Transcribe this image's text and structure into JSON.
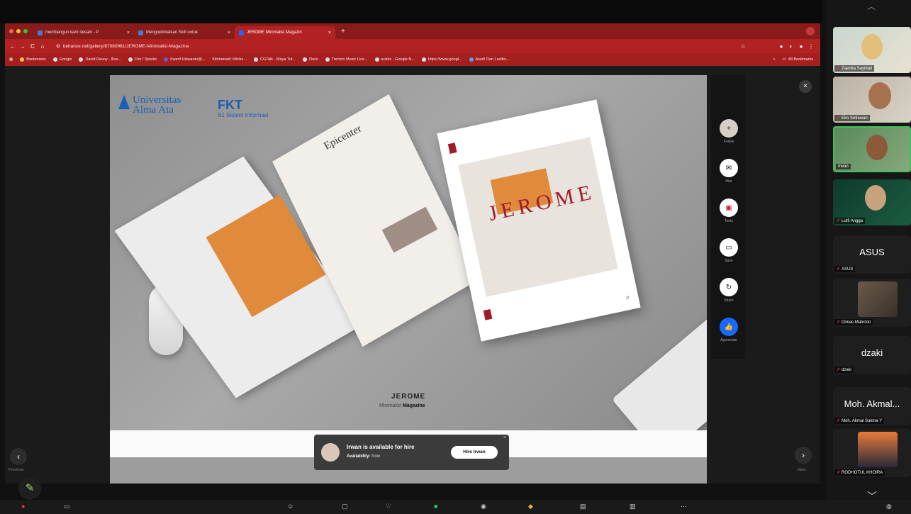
{
  "browser": {
    "tabs": [
      {
        "label": "membangun karir desain - P"
      },
      {
        "label": "Mengoptimalkan Skill untuk"
      },
      {
        "label": "JEROME Minimalist Magazin"
      }
    ],
    "url": "behance.net/gallery/87080981/JEROME-Minimalist-Magazine",
    "bookmarks": [
      "Bookmarks",
      "Google",
      "David Revoy - Illus...",
      "Fire / Sparks",
      "Irwanf Hiswanto@...",
      "Kitchenaid: Kitche...",
      "CGTalk - Maya Tut...",
      "Docs",
      "Trenton Music Lice...",
      "autolx - Google N...",
      "https://www.googl...",
      "Arazil Dan Lucifer..."
    ],
    "all_bookmarks": "All Bookmarks"
  },
  "project": {
    "uni_line1": "Universitas",
    "uni_line2": "Alma Ata",
    "fkt": "FKT",
    "fkt_sub": "S1 Sistem Informasi",
    "epicenter": "Epicenter",
    "jerome_cover": "JEROME",
    "caption_title": "JEROME",
    "caption_sub1": "Minimalist",
    "caption_sub2": "Magazine"
  },
  "rail": [
    {
      "icon": "follow-icon",
      "label": "Follow",
      "glyph": "+"
    },
    {
      "icon": "hire-icon",
      "label": "Hire",
      "glyph": "✉"
    },
    {
      "icon": "tools-icon",
      "label": "Tools",
      "glyph": "▣"
    },
    {
      "icon": "save-icon",
      "label": "Save",
      "glyph": "▭"
    },
    {
      "icon": "share-icon",
      "label": "Share",
      "glyph": "↻"
    },
    {
      "icon": "appreciate-icon",
      "label": "Appreciate",
      "glyph": "👍"
    }
  ],
  "navigation": {
    "previous": "Previous",
    "next": "Next"
  },
  "hire": {
    "title": "Irwan is available for hire",
    "availability_label": "Availability:",
    "availability_value": "Now",
    "button": "Hire Irwan"
  },
  "participants": [
    {
      "name": "Zaenita Sayidati",
      "type": "video"
    },
    {
      "name": "Eko Setiawan",
      "type": "video"
    },
    {
      "name": "Irwan",
      "type": "video"
    },
    {
      "name": "Lutfi Angga",
      "type": "video"
    },
    {
      "name": "ASUS",
      "type": "text",
      "big": "ASUS"
    },
    {
      "name": "Dimas Mahrizki",
      "type": "photo"
    },
    {
      "name": "dzaki",
      "type": "text",
      "big": "dzaki"
    },
    {
      "name": "Moh. Akmal Sukma Y",
      "type": "text",
      "big": "Moh. Akmal..."
    },
    {
      "name": "RODHOTUL KHOIRA",
      "type": "photo"
    }
  ]
}
